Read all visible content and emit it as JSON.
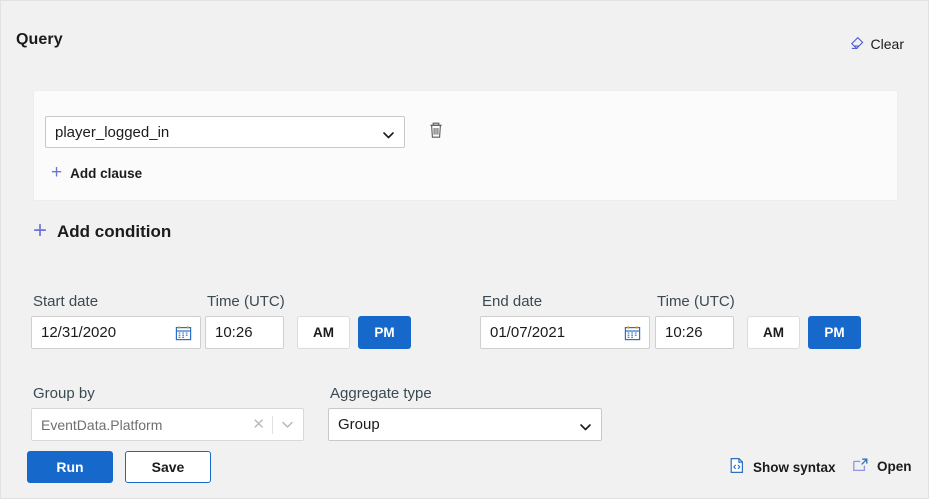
{
  "header": {
    "title": "Query",
    "clear_label": "Clear",
    "clear_icon": "eraser-icon"
  },
  "clause": {
    "event_value": "player_logged_in",
    "event_options": [
      "player_logged_in"
    ],
    "delete_icon": "trash-icon",
    "add_clause_label": "Add clause",
    "add_clause_icon": "plus-icon"
  },
  "add_condition": {
    "label": "Add condition",
    "icon": "plus-icon"
  },
  "start": {
    "date_label": "Start date",
    "date_value": "12/31/2020",
    "calendar_icon": "calendar-icon",
    "time_label": "Time (UTC)",
    "time_value": "10:26",
    "am_label": "AM",
    "pm_label": "PM",
    "meridiem_selected": "PM"
  },
  "end": {
    "date_label": "End date",
    "date_value": "01/07/2021",
    "calendar_icon": "calendar-icon",
    "time_label": "Time (UTC)",
    "time_value": "10:26",
    "am_label": "AM",
    "pm_label": "PM",
    "meridiem_selected": "PM"
  },
  "group_by": {
    "label": "Group by",
    "value": "EventData.Platform",
    "clear_icon": "close-icon",
    "chevron_icon": "chevron-down-icon"
  },
  "aggregate": {
    "label": "Aggregate type",
    "value": "Group",
    "options": [
      "Group"
    ],
    "chevron_icon": "chevron-down-icon"
  },
  "footer": {
    "run_label": "Run",
    "save_label": "Save",
    "show_syntax_label": "Show syntax",
    "show_syntax_icon": "code-file-icon",
    "open_label": "Open",
    "open_icon": "external-link-icon"
  },
  "colors": {
    "accent": "#1668cb",
    "page_bg": "#f1f1f1",
    "panel_bg": "#fbfbfb",
    "plus_accent": "#6b76d8",
    "text": "#1b1b1b",
    "label": "#3a4a52"
  }
}
